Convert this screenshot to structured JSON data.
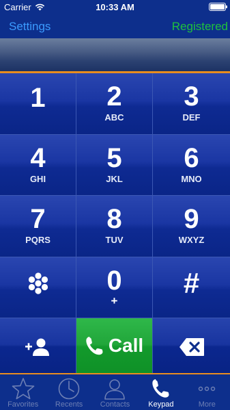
{
  "status_bar": {
    "carrier": "Carrier",
    "time": "10:33 AM",
    "battery_level": 1.0
  },
  "header": {
    "settings_label": "Settings",
    "registration_status": "Registered",
    "settings_color": "#3b9bff",
    "status_color": "#1fc23d"
  },
  "display": {
    "number": ""
  },
  "keypad": {
    "keys": [
      {
        "digit": "1",
        "letters": ""
      },
      {
        "digit": "2",
        "letters": "ABC"
      },
      {
        "digit": "3",
        "letters": "DEF"
      },
      {
        "digit": "4",
        "letters": "GHI"
      },
      {
        "digit": "5",
        "letters": "JKL"
      },
      {
        "digit": "6",
        "letters": "MNO"
      },
      {
        "digit": "7",
        "letters": "PQRS"
      },
      {
        "digit": "8",
        "letters": "TUV"
      },
      {
        "digit": "9",
        "letters": "WXYZ"
      },
      {
        "digit": "",
        "letters": "",
        "icon": "asterisk-flower-icon"
      },
      {
        "digit": "0",
        "letters": "+"
      },
      {
        "digit": "#",
        "letters": ""
      }
    ]
  },
  "actions": {
    "add_contact_icon": "add-contact-icon",
    "call_label": "Call",
    "call_color": "#1fa636",
    "backspace_icon": "backspace-icon"
  },
  "tab_bar": {
    "tabs": [
      {
        "label": "Favorites",
        "icon": "star-icon",
        "active": false
      },
      {
        "label": "Recents",
        "icon": "clock-icon",
        "active": false
      },
      {
        "label": "Contacts",
        "icon": "person-icon",
        "active": false
      },
      {
        "label": "Keypad",
        "icon": "phone-icon",
        "active": true
      },
      {
        "label": "More",
        "icon": "more-dots-icon",
        "active": false
      }
    ]
  },
  "colors": {
    "accent_orange": "#e88d1f",
    "keypad_blue": "#1a36a3"
  }
}
